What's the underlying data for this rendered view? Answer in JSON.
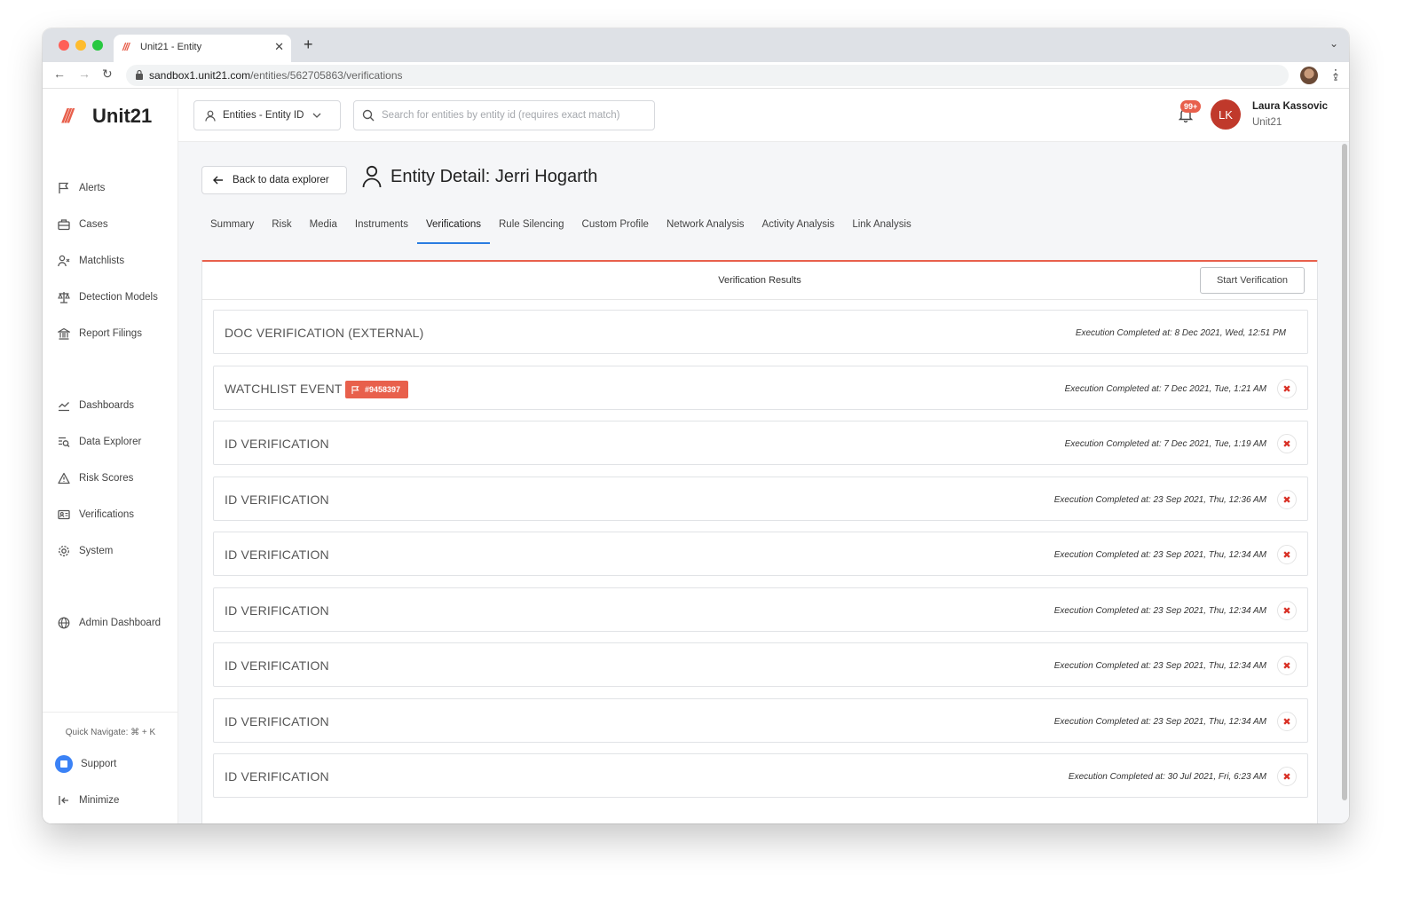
{
  "browser": {
    "tab_title": "Unit21 - Entity",
    "url_host": "sandbox1.unit21.com",
    "url_path": "/entities/562705863/verifications"
  },
  "sidebar": {
    "logo_text": "Unit21",
    "items": [
      {
        "label": "Alerts",
        "icon": "flag-icon"
      },
      {
        "label": "Cases",
        "icon": "briefcase-icon"
      },
      {
        "label": "Matchlists",
        "icon": "user-x-icon"
      },
      {
        "label": "Detection Models",
        "icon": "scale-icon"
      },
      {
        "label": "Report Filings",
        "icon": "bank-icon"
      },
      {
        "label": "Dashboards",
        "icon": "chart-line-icon"
      },
      {
        "label": "Data Explorer",
        "icon": "data-search-icon"
      },
      {
        "label": "Risk Scores",
        "icon": "warning-triangle-icon"
      },
      {
        "label": "Verifications",
        "icon": "id-card-icon"
      },
      {
        "label": "System",
        "icon": "gear-icon"
      },
      {
        "label": "Admin Dashboard",
        "icon": "globe-icon"
      }
    ],
    "quick_navigate": "Quick Navigate: ⌘ + K",
    "support": "Support",
    "minimize": "Minimize"
  },
  "topbar": {
    "entity_select": "Entities - Entity ID",
    "search_placeholder": "Search for entities by entity id (requires exact match)",
    "notif_count": "99+",
    "avatar_initials": "LK",
    "user_name": "Laura Kassovic",
    "user_org": "Unit21"
  },
  "page": {
    "back_label": "Back to data explorer",
    "title": "Entity Detail: Jerri Hogarth",
    "tabs": [
      "Summary",
      "Risk",
      "Media",
      "Instruments",
      "Verifications",
      "Rule Silencing",
      "Custom Profile",
      "Network Analysis",
      "Activity Analysis",
      "Link Analysis"
    ],
    "active_tab": "Verifications"
  },
  "verifications": {
    "panel_title": "Verification Results",
    "start_label": "Start Verification",
    "rows": [
      {
        "title": "DOC VERIFICATION (EXTERNAL)",
        "time": "Execution Completed at: 8 Dec 2021, Wed, 12:51 PM",
        "deletable": false
      },
      {
        "title": "WATCHLIST EVENT",
        "badge": "#9458397",
        "time": "Execution Completed at: 7 Dec 2021, Tue, 1:21 AM",
        "deletable": true
      },
      {
        "title": "ID VERIFICATION",
        "time": "Execution Completed at: 7 Dec 2021, Tue, 1:19 AM",
        "deletable": true
      },
      {
        "title": "ID VERIFICATION",
        "time": "Execution Completed at: 23 Sep 2021, Thu, 12:36 AM",
        "deletable": true
      },
      {
        "title": "ID VERIFICATION",
        "time": "Execution Completed at: 23 Sep 2021, Thu, 12:34 AM",
        "deletable": true
      },
      {
        "title": "ID VERIFICATION",
        "time": "Execution Completed at: 23 Sep 2021, Thu, 12:34 AM",
        "deletable": true
      },
      {
        "title": "ID VERIFICATION",
        "time": "Execution Completed at: 23 Sep 2021, Thu, 12:34 AM",
        "deletable": true
      },
      {
        "title": "ID VERIFICATION",
        "time": "Execution Completed at: 23 Sep 2021, Thu, 12:34 AM",
        "deletable": true
      },
      {
        "title": "ID VERIFICATION",
        "time": "Execution Completed at: 30 Jul 2021, Fri, 6:23 AM",
        "deletable": true
      }
    ]
  },
  "colors": {
    "brand": "#e8604c",
    "active_tab": "#2a7de1",
    "delete": "#d93025"
  }
}
